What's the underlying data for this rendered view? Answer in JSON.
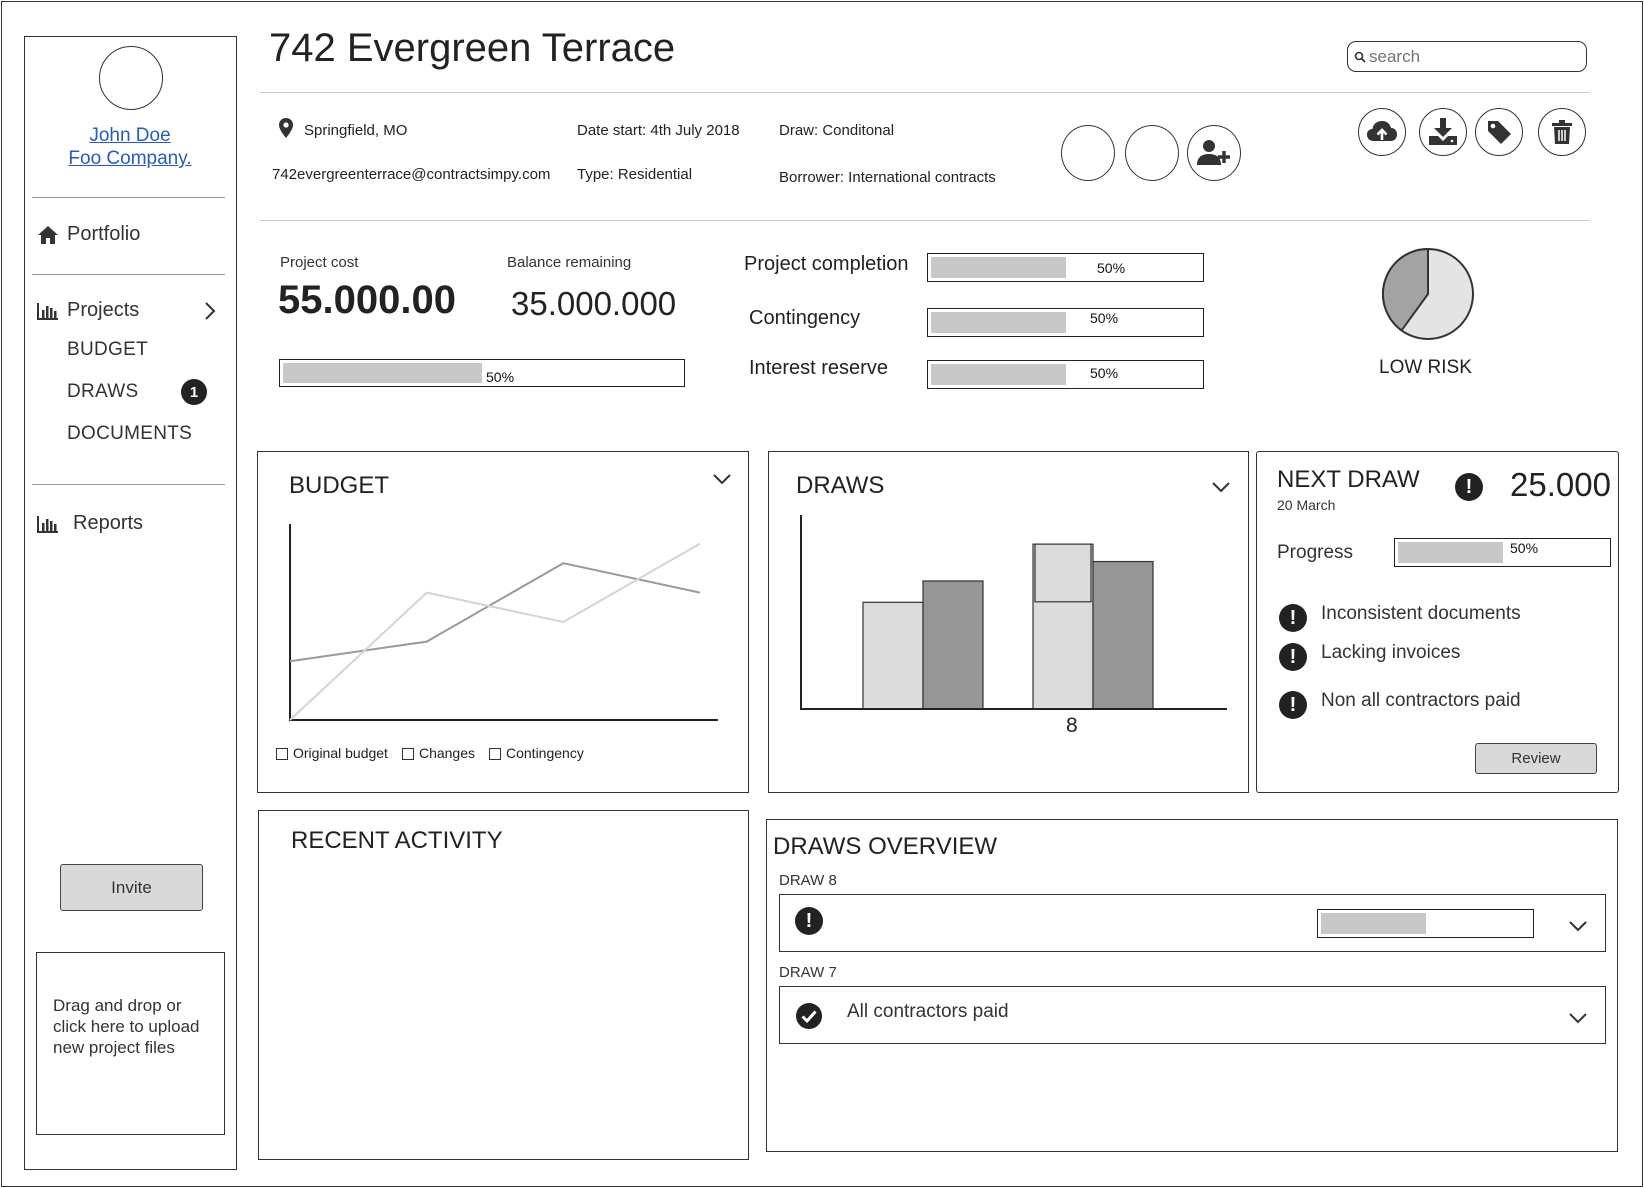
{
  "page": {
    "title": "742 Evergreen Terrace",
    "search_placeholder": "search"
  },
  "sidebar": {
    "user_name": "John Doe",
    "company": "Foo Company.",
    "portfolio_label": "Portfolio",
    "projects_label": "Projects",
    "sub_items": [
      "BUDGET",
      "DRAWS",
      "DOCUMENTS"
    ],
    "draws_badge": "1",
    "reports_label": "Reports",
    "invite_label": "Invite",
    "upload_text": "Drag and drop or click here to upload new project files"
  },
  "info": {
    "location": "Springfield, MO",
    "email": "742evergreenterrace@contractsimpy.com",
    "date_start": "Date start: 4th July 2018",
    "type": "Type: Residential",
    "draw": "Draw: Conditonal",
    "borrower": "Borrower: International contracts"
  },
  "toolbar": {
    "icons": [
      "cloud-upload-icon",
      "download-icon",
      "tag-icon",
      "trash-icon"
    ]
  },
  "summary": {
    "project_cost_label": "Project cost",
    "project_cost": "55.000.00",
    "balance_label": "Balance remaining",
    "balance": "35.000.000",
    "cost_progress": 0.5,
    "cost_progress_label": "50%",
    "metrics": [
      {
        "label": "Project completion",
        "value": 0.5,
        "pct": "50%"
      },
      {
        "label": "Contingency",
        "value": 0.5,
        "pct": "50%"
      },
      {
        "label": "Interest reserve",
        "value": 0.5,
        "pct": "50%"
      }
    ],
    "risk_label": "LOW RISK",
    "risk_pie": [
      0.4,
      0.6
    ]
  },
  "budget_panel": {
    "title": "BUDGET",
    "legend": [
      "Original budget",
      "Changes",
      "Contingency"
    ]
  },
  "chart_data": [
    {
      "type": "line",
      "title": "BUDGET",
      "x": [
        0,
        1,
        2,
        3
      ],
      "series": [
        {
          "name": "Original budget",
          "values": [
            0.3,
            0.4,
            0.8,
            0.65
          ],
          "color": "#9a9a9a"
        },
        {
          "name": "Changes",
          "values": [
            0.0,
            0.65,
            0.5,
            0.9
          ],
          "color": "#d4d4d4"
        }
      ],
      "ylim": [
        0,
        1
      ]
    },
    {
      "type": "bar",
      "title": "DRAWS",
      "categories": [
        "",
        "8"
      ],
      "series": [
        {
          "values": [
            0.55,
            0.85
          ],
          "color": "#dcdcdc"
        },
        {
          "values": [
            0.66,
            0.76
          ],
          "color": "#969696"
        }
      ],
      "ylim": [
        0,
        1
      ]
    }
  ],
  "draws_panel": {
    "title": "DRAWS",
    "x_label": "8"
  },
  "next_draw": {
    "title": "NEXT DRAW",
    "date": "20 March",
    "amount": "25.000",
    "progress_label": "Progress",
    "progress": 0.5,
    "progress_pct": "50%",
    "issues": [
      "Inconsistent documents",
      "Lacking invoices",
      "Non all contractors paid"
    ],
    "review_label": "Review"
  },
  "recent_activity": {
    "title": "RECENT ACTIVITY"
  },
  "draws_overview": {
    "title": "DRAWS OVERVIEW",
    "draws": [
      {
        "label": "DRAW 8",
        "status": "",
        "progress": 0.5
      },
      {
        "label": "DRAW 7",
        "status": "All contractors paid"
      }
    ]
  }
}
